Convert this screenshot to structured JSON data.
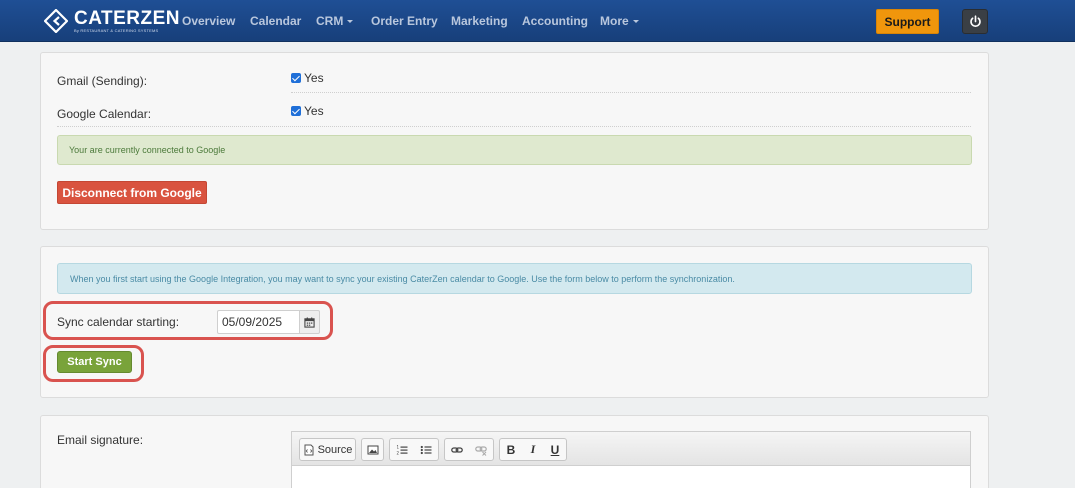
{
  "brand": {
    "name": "CATERZEN",
    "tagline": "By RESTAURANT & CATERING SYSTEMS"
  },
  "nav": {
    "overview": "Overview",
    "calendar": "Calendar",
    "crm": "CRM",
    "order_entry": "Order Entry",
    "marketing": "Marketing",
    "accounting": "Accounting",
    "more": "More",
    "support": "Support"
  },
  "google": {
    "gmail_label": "Gmail (Sending):",
    "gmail_value": "Yes",
    "gmail_checked": true,
    "calendar_label": "Google Calendar:",
    "calendar_value": "Yes",
    "calendar_checked": true,
    "connected_message": "Your are currently connected to Google",
    "disconnect_label": "Disconnect from Google"
  },
  "sync": {
    "info_message": "When you first start using the Google Integration, you may want to sync your existing CaterZen calendar to Google. Use the form below to perform the synchronization.",
    "start_label": "Sync calendar starting:",
    "start_date": "05/09/2025",
    "start_button": "Start Sync"
  },
  "signature": {
    "label": "Email signature:",
    "toolbar": {
      "source": "Source",
      "bold": "B",
      "italic": "I",
      "underline": "U"
    }
  },
  "colors": {
    "navbar": "#1f4f95",
    "support": "#f0960c",
    "danger": "#d9533f",
    "success": "#79a33a",
    "highlight": "#d9534f"
  },
  "icons": [
    "caterzen-logo-icon",
    "power-icon",
    "calendar-icon",
    "source-icon",
    "image-icon",
    "numbered-list-icon",
    "bulleted-list-icon",
    "link-icon",
    "unlink-icon"
  ]
}
